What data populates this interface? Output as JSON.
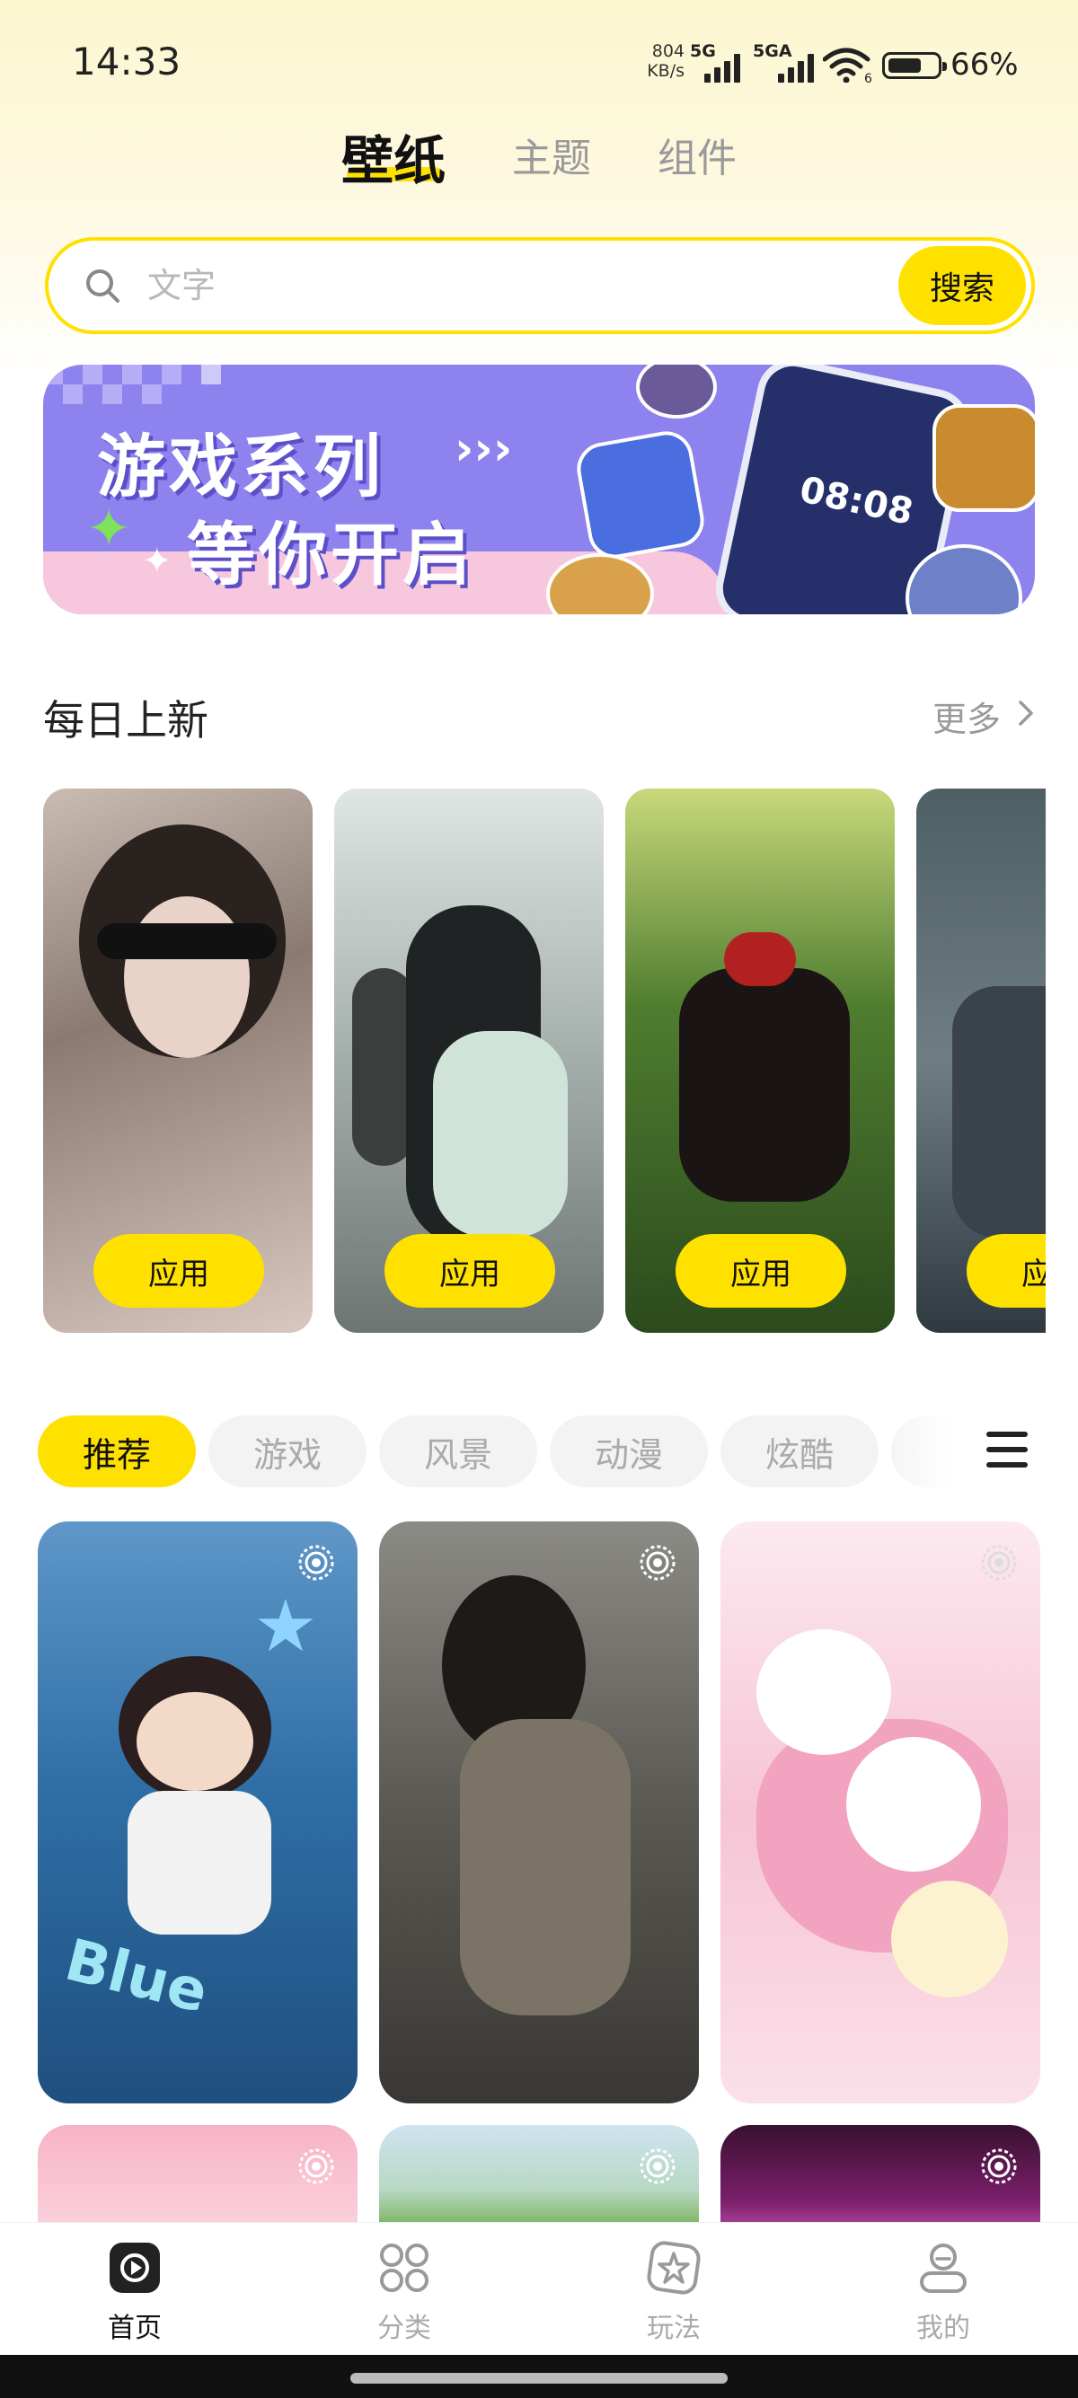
{
  "status_bar": {
    "time": "14:33",
    "net_speed_value": "804",
    "net_speed_unit": "KB/s",
    "signal1_label": "5G",
    "signal2_label": "5GA",
    "wifi_label": "6",
    "battery_percent": "66%",
    "battery_level": 0.66
  },
  "top_tabs": [
    {
      "label": "壁纸",
      "active": true
    },
    {
      "label": "主题",
      "active": false
    },
    {
      "label": "组件",
      "active": false
    }
  ],
  "search": {
    "placeholder": "文字",
    "button_label": "搜索"
  },
  "banner": {
    "line1": "游戏系列",
    "arrows": "›››",
    "line2": "等你开启",
    "phone_clock": "08:08"
  },
  "daily_section": {
    "title": "每日上新",
    "more_label": "更多"
  },
  "daily_cards": [
    {
      "apply_label": "应用"
    },
    {
      "apply_label": "应用"
    },
    {
      "apply_label": "应用"
    },
    {
      "apply_label": "应用"
    }
  ],
  "categories": [
    {
      "label": "推荐",
      "active": true
    },
    {
      "label": "游戏",
      "active": false
    },
    {
      "label": "风景",
      "active": false
    },
    {
      "label": "动漫",
      "active": false
    },
    {
      "label": "炫酷",
      "active": false
    },
    {
      "label": "",
      "active": false
    }
  ],
  "grid_tiles": [
    {
      "text": "Blue",
      "live": true
    },
    {
      "text": "",
      "live": true
    },
    {
      "text": "",
      "live": true
    },
    {
      "text": "",
      "live": true
    },
    {
      "text": "",
      "live": true
    },
    {
      "text": "",
      "live": true
    }
  ],
  "bottom_nav": [
    {
      "label": "首页",
      "icon": "play-square-icon",
      "active": true
    },
    {
      "label": "分类",
      "icon": "grid-circles-icon",
      "active": false
    },
    {
      "label": "玩法",
      "icon": "star-badge-icon",
      "active": false
    },
    {
      "label": "我的",
      "icon": "user-icon",
      "active": false
    }
  ],
  "colors": {
    "accent": "#ffe100",
    "text_primary": "#111111",
    "text_muted": "#aaaaaa"
  }
}
